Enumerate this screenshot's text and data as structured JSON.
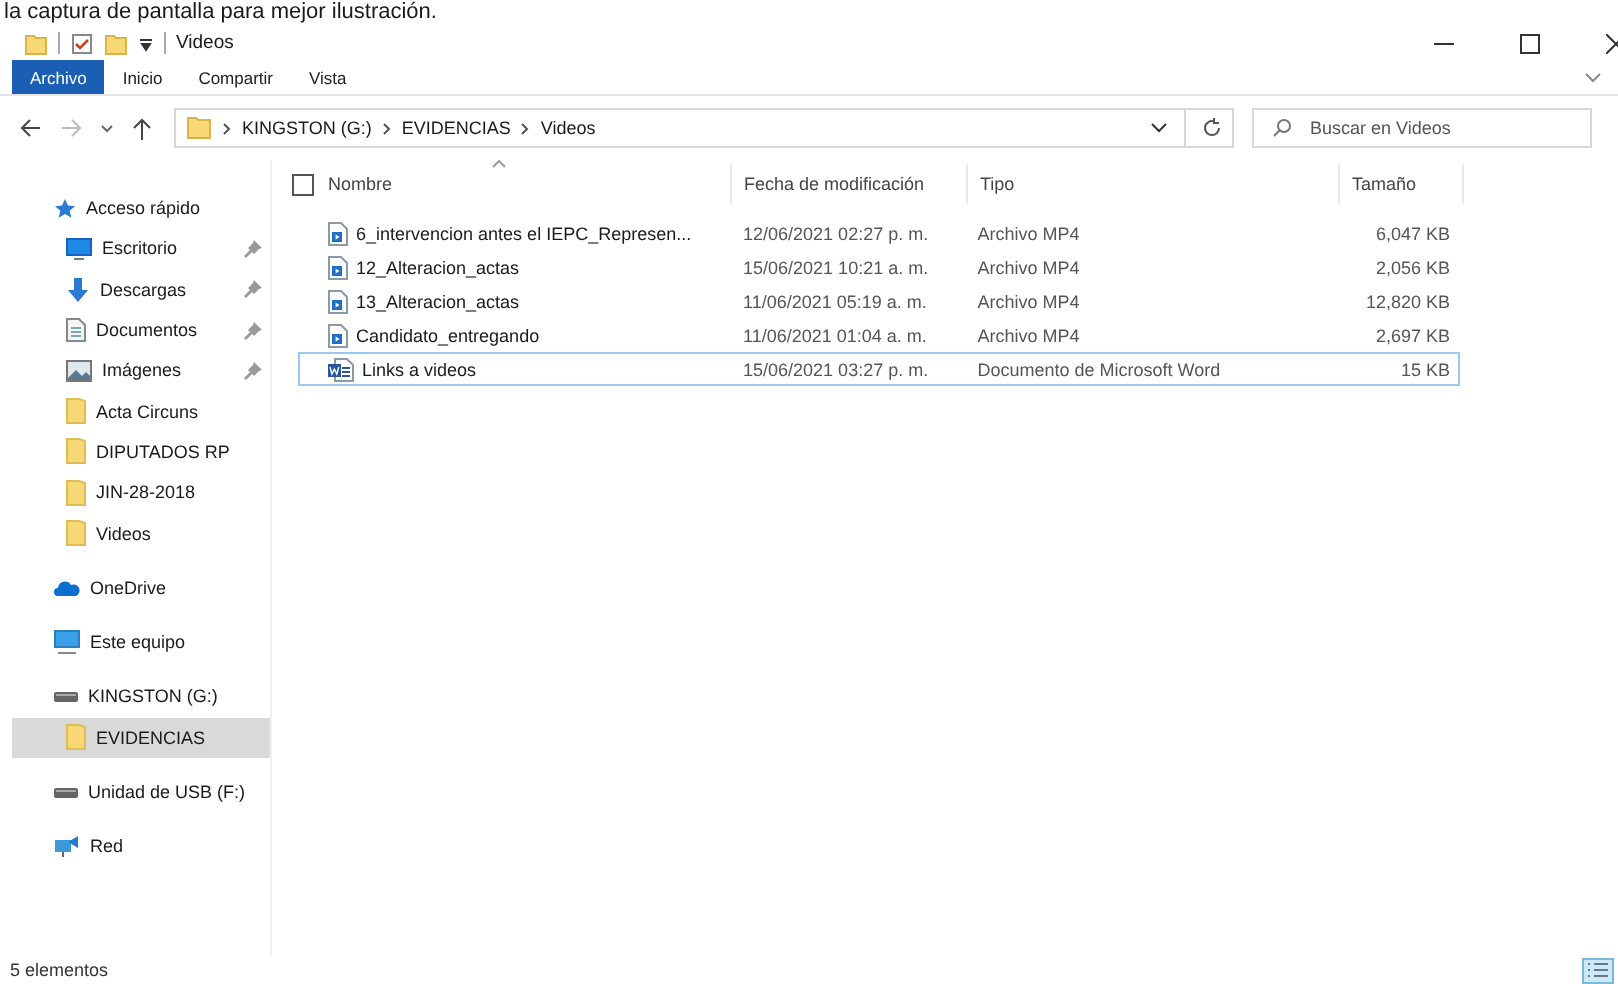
{
  "caption": "la captura de pantalla para mejor ilustración.",
  "window": {
    "title": "Videos"
  },
  "ribbon_tabs": [
    {
      "label": "Archivo",
      "selected": true
    },
    {
      "label": "Inicio",
      "selected": false
    },
    {
      "label": "Compartir",
      "selected": false
    },
    {
      "label": "Vista",
      "selected": false
    }
  ],
  "address": {
    "path": [
      "KINGSTON (G:)",
      "EVIDENCIAS",
      "Videos"
    ]
  },
  "search": {
    "placeholder": "Buscar en Videos"
  },
  "sidebar": {
    "items": [
      {
        "label": "Acceso rápido",
        "kind": "star",
        "selected": false,
        "children": [
          {
            "label": "Escritorio",
            "kind": "desktop",
            "pinned": true,
            "selected": false
          },
          {
            "label": "Descargas",
            "kind": "download",
            "pinned": true,
            "selected": false
          },
          {
            "label": "Documentos",
            "kind": "document",
            "pinned": true,
            "selected": false
          },
          {
            "label": "Imágenes",
            "kind": "image",
            "pinned": true,
            "selected": false
          },
          {
            "label": "Acta Circuns",
            "kind": "folder",
            "pinned": false,
            "selected": false
          },
          {
            "label": "DIPUTADOS RP",
            "kind": "folder",
            "pinned": false,
            "selected": false
          },
          {
            "label": "JIN-28-2018",
            "kind": "folder",
            "pinned": false,
            "selected": false
          },
          {
            "label": "Videos",
            "kind": "folder",
            "pinned": false,
            "selected": false
          }
        ]
      },
      {
        "label": "OneDrive",
        "kind": "cloud",
        "selected": false
      },
      {
        "label": "Este equipo",
        "kind": "computer",
        "selected": false
      },
      {
        "label": "KINGSTON (G:)",
        "kind": "drive",
        "selected": false,
        "children": [
          {
            "label": "EVIDENCIAS",
            "kind": "folder",
            "pinned": false,
            "selected": true
          }
        ]
      },
      {
        "label": "Unidad de USB (F:)",
        "kind": "drive",
        "selected": false
      },
      {
        "label": "Red",
        "kind": "network",
        "selected": false
      }
    ]
  },
  "table": {
    "columns": [
      "Nombre",
      "Fecha de modificación",
      "Tipo",
      "Tamaño"
    ],
    "select_all_checked": false,
    "rows": [
      {
        "kind": "video",
        "name": "6_intervencion antes el IEPC_Represen...",
        "date": "12/06/2021 02:27 p. m.",
        "type": "Archivo MP4",
        "size": "6,047 KB",
        "selected": false
      },
      {
        "kind": "video",
        "name": "12_Alteracion_actas",
        "date": "15/06/2021 10:21 a. m.",
        "type": "Archivo MP4",
        "size": "2,056 KB",
        "selected": false
      },
      {
        "kind": "video",
        "name": "13_Alteracion_actas",
        "date": "11/06/2021 05:19 a. m.",
        "type": "Archivo MP4",
        "size": "12,820 KB",
        "selected": false
      },
      {
        "kind": "video",
        "name": "Candidato_entregando",
        "date": "11/06/2021 01:04 a. m.",
        "type": "Archivo MP4",
        "size": "2,697 KB",
        "selected": false
      },
      {
        "kind": "word",
        "name": "Links a videos",
        "date": "15/06/2021 03:27 p. m.",
        "type": "Documento de Microsoft Word",
        "size": "15 KB",
        "selected": true
      }
    ]
  },
  "status_bar": {
    "count": "5 elementos"
  }
}
